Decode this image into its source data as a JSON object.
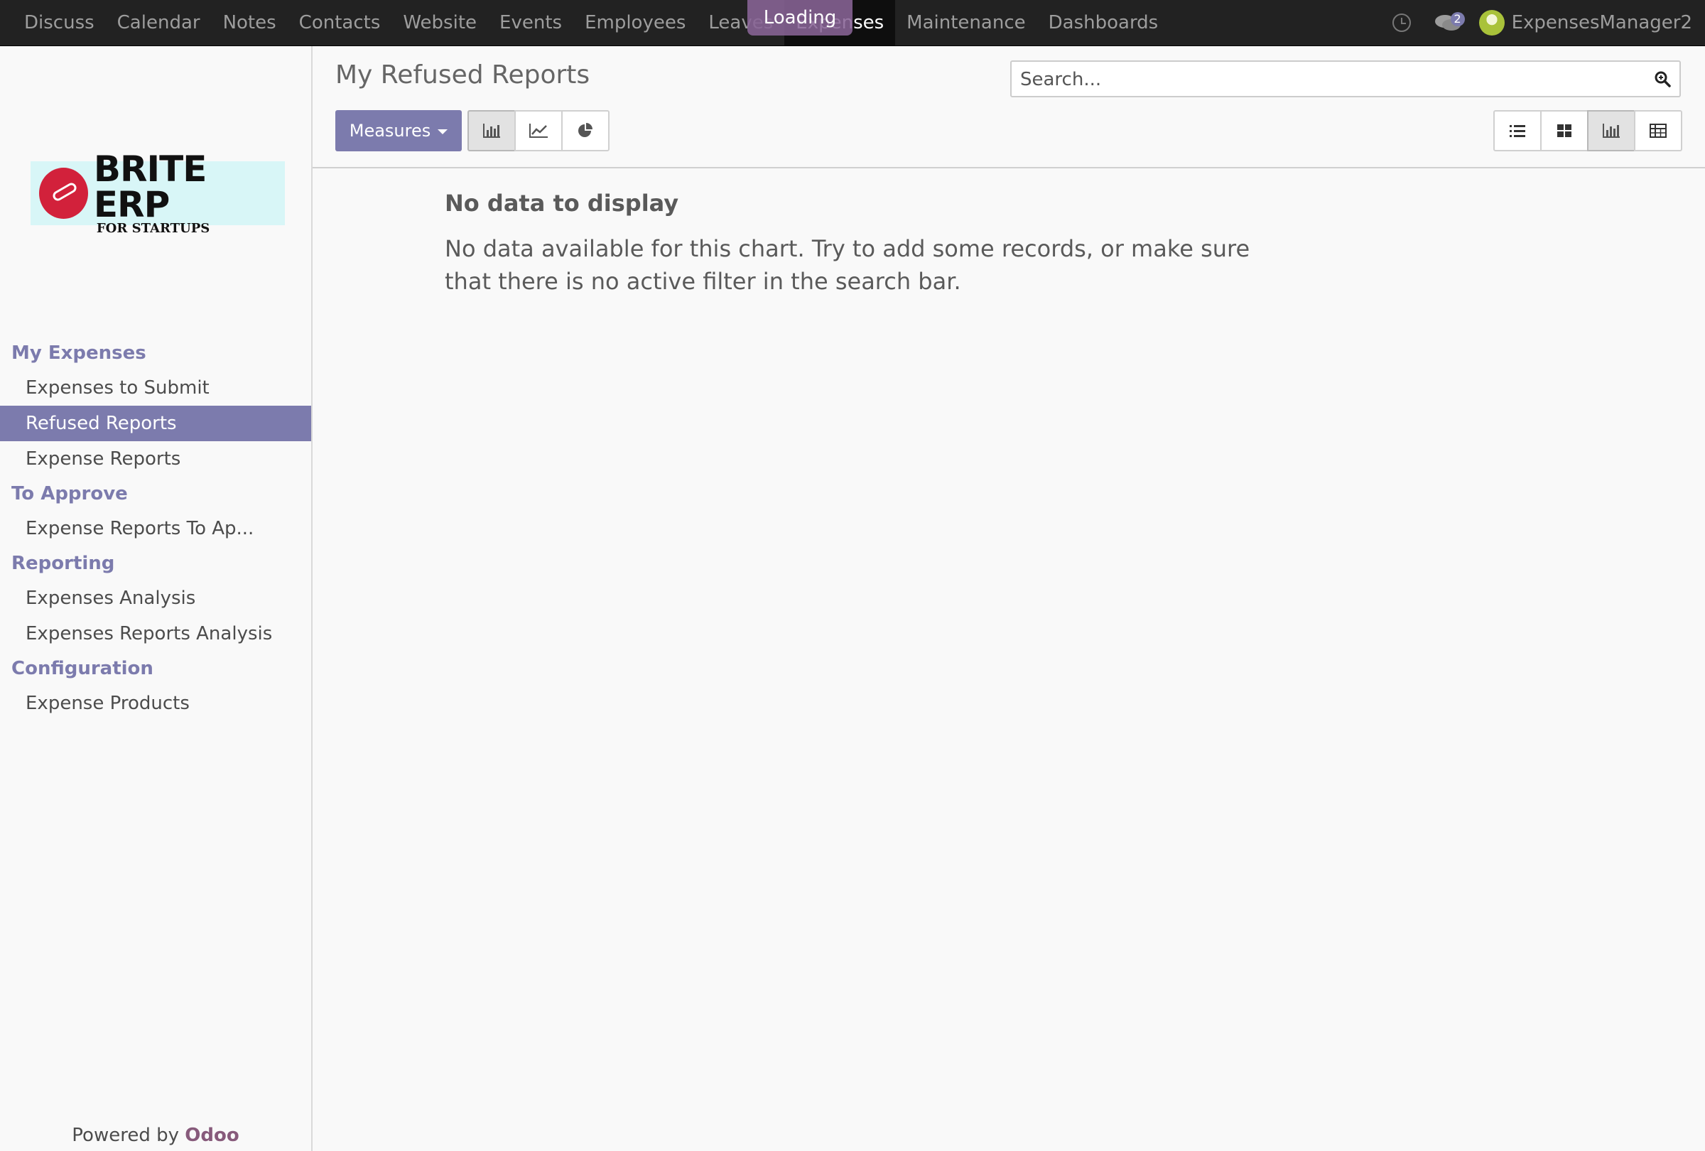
{
  "topbar": {
    "apps": [
      "Discuss",
      "Calendar",
      "Notes",
      "Contacts",
      "Website",
      "Events",
      "Employees",
      "Leaves",
      "Expenses",
      "Maintenance",
      "Dashboards"
    ],
    "active_app": "Expenses",
    "loading_label": "Loading",
    "chat_count": "2",
    "user_name": "ExpensesManager2",
    "icons": [
      "clock-icon",
      "chat-icon",
      "avatar"
    ]
  },
  "sidebar": {
    "logo": {
      "title": "BRITE ERP",
      "subtitle": "FOR STARTUPS"
    },
    "sections": [
      {
        "header": "My Expenses",
        "items": [
          "Expenses to Submit",
          "Refused Reports",
          "Expense Reports"
        ]
      },
      {
        "header": "To Approve",
        "items": [
          "Expense Reports To Ap..."
        ]
      },
      {
        "header": "Reporting",
        "items": [
          "Expenses Analysis",
          "Expenses Reports Analysis"
        ]
      },
      {
        "header": "Configuration",
        "items": [
          "Expense Products"
        ]
      }
    ],
    "active_item": "Refused Reports",
    "powered_by": "Powered by",
    "powered_brand": "Odoo"
  },
  "control_panel": {
    "breadcrumb": "My Refused Reports",
    "search_placeholder": "Search...",
    "measures_label": "Measures",
    "chart_modes": [
      {
        "name": "bar-chart-icon",
        "active": true
      },
      {
        "name": "line-chart-icon",
        "active": false
      },
      {
        "name": "pie-chart-icon",
        "active": false
      }
    ],
    "views": [
      {
        "name": "list-view-icon",
        "active": false
      },
      {
        "name": "kanban-view-icon",
        "active": false
      },
      {
        "name": "graph-view-icon",
        "active": true
      },
      {
        "name": "pivot-view-icon",
        "active": false
      }
    ]
  },
  "content": {
    "no_data_title": "No data to display",
    "no_data_text": "No data available for this chart. Try to add some records, or make sure that there is no active filter in the search bar."
  },
  "colors": {
    "accent": "#7c7bad",
    "topbar_bg": "#222222",
    "brand": "#875a7b"
  }
}
